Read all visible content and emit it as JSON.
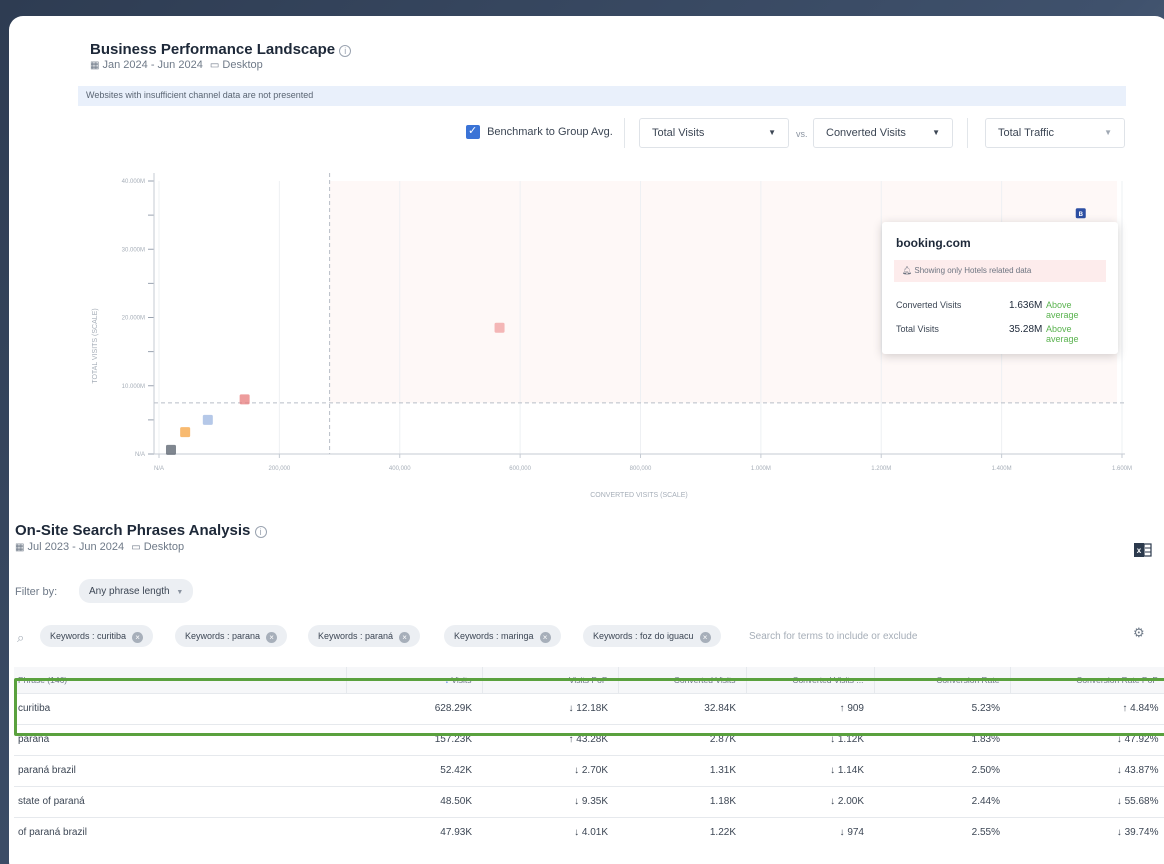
{
  "bpl": {
    "title": "Business Performance Landscape",
    "date_range": "Jan 2024 - Jun 2024",
    "device": "Desktop",
    "notice": "Websites with insufficient channel data are not presented",
    "benchmark_label": "Benchmark to Group Avg.",
    "y_metric": "Total Visits",
    "vs_label": "vs.",
    "x_metric": "Converted Visits",
    "size_metric": "Total Traffic"
  },
  "chart_data": {
    "type": "scatter",
    "xlabel": "CONVERTED VISITS (SCALE)",
    "ylabel": "TOTAL VISITS (SCALE)",
    "x_tick_labels": [
      "N/A",
      "200,000",
      "400,000",
      "600,000",
      "800,000",
      "1.000M",
      "1.200M",
      "1.400M",
      "1.600M"
    ],
    "y_tick_labels": [
      "N/A",
      "10.000M",
      "20.000M",
      "30.000M",
      "40.000M"
    ],
    "xlim": [
      0,
      1700000
    ],
    "ylim": [
      0,
      40000000
    ],
    "benchmark_x": 310000,
    "benchmark_y": 7500000,
    "points": [
      {
        "label": "booking.com",
        "x": 1636000,
        "y": 35280000,
        "color": "#2d4fa3"
      },
      {
        "label": "",
        "x": 610000,
        "y": 18500000,
        "color": "#f0a0a0"
      },
      {
        "label": "",
        "x": 160000,
        "y": 8000000,
        "color": "#e77b7b"
      },
      {
        "label": "",
        "x": 55000,
        "y": 3200000,
        "color": "#f5a340"
      },
      {
        "label": "",
        "x": 95000,
        "y": 5000000,
        "color": "#9cb5e0"
      },
      {
        "label": "",
        "x": 30000,
        "y": 600000,
        "color": "#555f6b"
      }
    ]
  },
  "tooltip": {
    "site": "booking.com",
    "warning": "Showing only Hotels related data",
    "rows": [
      {
        "label": "Converted Visits",
        "value": "1.636M",
        "assessment": "Above average"
      },
      {
        "label": "Total Visits",
        "value": "35.28M",
        "assessment": "Above average"
      }
    ]
  },
  "ospa": {
    "title": "On-Site Search Phrases Analysis",
    "date_range": "Jul 2023 - Jun 2024",
    "device": "Desktop",
    "filter_by": "Filter by:",
    "phrase_length": "Any phrase length",
    "search_placeholder": "Search for terms to include or exclude",
    "keyword_chips": [
      "Keywords : curitiba",
      "Keywords : parana",
      "Keywords : paraná",
      "Keywords : maringa",
      "Keywords : foz do iguacu"
    ]
  },
  "table": {
    "columns": [
      "Phrase (146)",
      "Visits",
      "Visits PoP",
      "Converted Visits",
      "Converted Visits ...",
      "Conversion Rate",
      "Conversion Rate PoP"
    ],
    "rows": [
      {
        "phrase": "curitiba",
        "visits": "628.29K",
        "visits_pop": "12.18K",
        "visits_pop_dir": "down",
        "conv": "32.84K",
        "conv_pop": "909",
        "conv_pop_dir": "up",
        "rate": "5.23%",
        "rate_pop": "4.84%",
        "rate_pop_dir": "up"
      },
      {
        "phrase": "paraná",
        "visits": "157.23K",
        "visits_pop": "43.28K",
        "visits_pop_dir": "up",
        "conv": "2.87K",
        "conv_pop": "1.12K",
        "conv_pop_dir": "down",
        "rate": "1.83%",
        "rate_pop": "47.92%",
        "rate_pop_dir": "down"
      },
      {
        "phrase": "paraná brazil",
        "visits": "52.42K",
        "visits_pop": "2.70K",
        "visits_pop_dir": "down",
        "conv": "1.31K",
        "conv_pop": "1.14K",
        "conv_pop_dir": "down",
        "rate": "2.50%",
        "rate_pop": "43.87%",
        "rate_pop_dir": "down"
      },
      {
        "phrase": "state of paraná",
        "visits": "48.50K",
        "visits_pop": "9.35K",
        "visits_pop_dir": "down",
        "conv": "1.18K",
        "conv_pop": "2.00K",
        "conv_pop_dir": "down",
        "rate": "2.44%",
        "rate_pop": "55.68%",
        "rate_pop_dir": "down"
      },
      {
        "phrase": "of paraná brazil",
        "visits": "47.93K",
        "visits_pop": "4.01K",
        "visits_pop_dir": "down",
        "conv": "1.22K",
        "conv_pop": "974",
        "conv_pop_dir": "down",
        "rate": "2.55%",
        "rate_pop": "39.74%",
        "rate_pop_dir": "down"
      }
    ]
  }
}
